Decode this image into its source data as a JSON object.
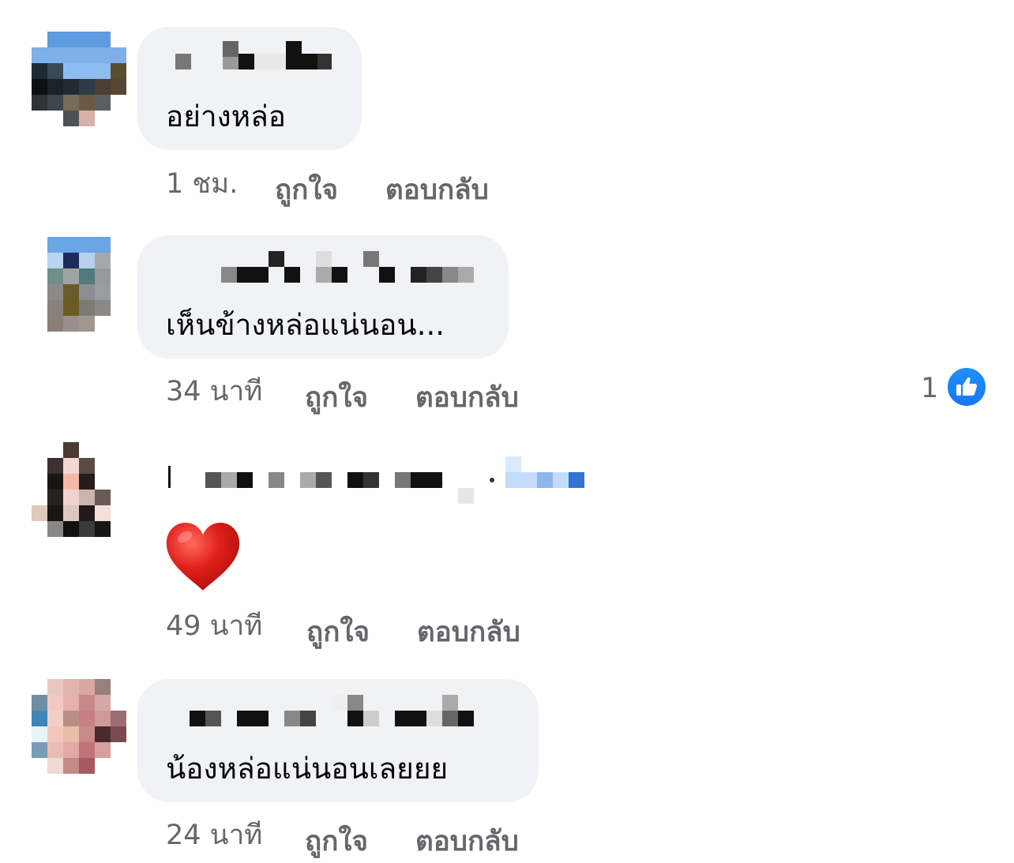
{
  "comments": [
    {
      "text": "อย่างหล่อ",
      "time": "1 ชม.",
      "like": "ถูกใจ",
      "reply": "ตอบกลับ",
      "reaction_count": ""
    },
    {
      "text": "เห็นข้างหล่อแน่นอน...",
      "time": "34 นาที",
      "like": "ถูกใจ",
      "reply": "ตอบกลับ",
      "reaction_count": "1"
    },
    {
      "text": "",
      "time": "49 นาที",
      "like": "ถูกใจ",
      "reply": "ตอบกลับ",
      "reaction_count": ""
    },
    {
      "text": "น้องหล่อแน่นอนเลยยย",
      "time": "24 นาที",
      "like": "ถูกใจ",
      "reply": "ตอบกลับ",
      "reaction_count": ""
    }
  ],
  "icons": {
    "reaction": "thumbs-up-icon",
    "sticker": "red-heart-icon"
  },
  "colors": {
    "bubble": "#f0f2f5",
    "meta": "#65676b",
    "like_blue": "#1877f2",
    "heart": "#e0201b"
  }
}
